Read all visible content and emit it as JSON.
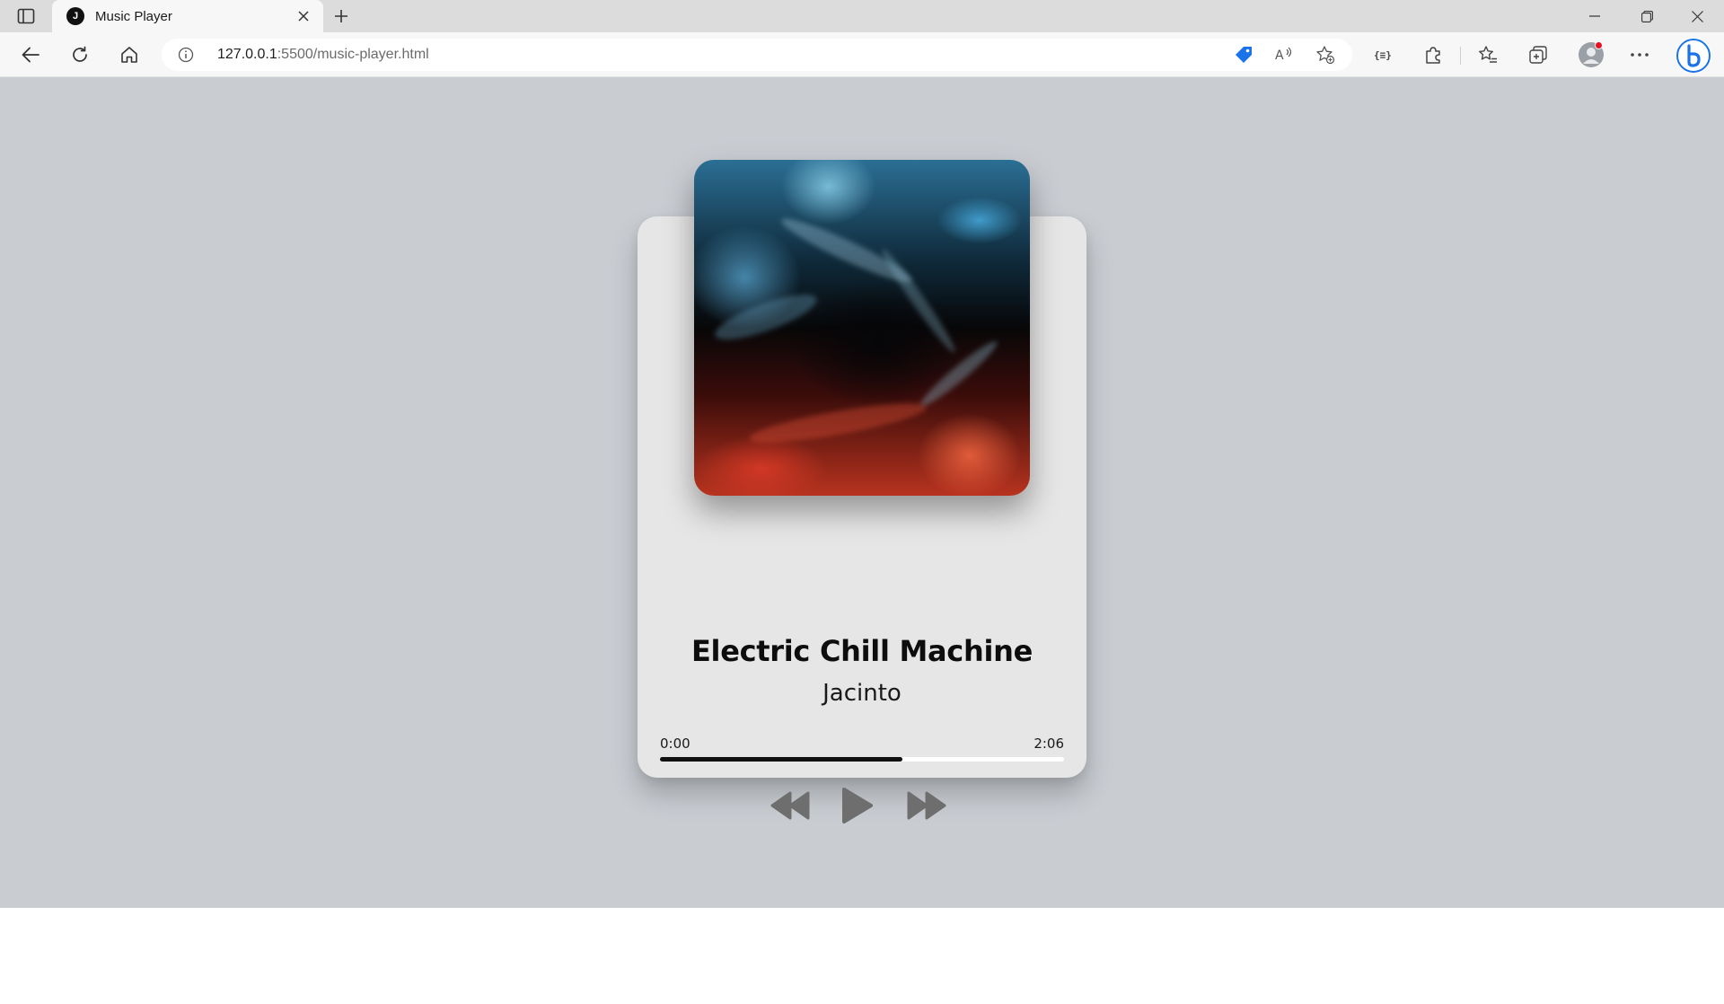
{
  "browser": {
    "tab": {
      "title": "Music Player",
      "favicon_letter": "J"
    },
    "address": {
      "host": "127.0.0.1",
      "rest": ":5500/music-player.html"
    }
  },
  "player": {
    "song_title": "Electric Chill Machine",
    "artist": "Jacinto",
    "current_time": "0:00",
    "duration": "2:06",
    "progress_fraction": 0.6,
    "controls": [
      "rewind-icon",
      "play-icon",
      "fast-forward-icon"
    ]
  },
  "colors": {
    "page_background": "#c9cdd2",
    "card_background": "#e6e6e6",
    "progress_fill": "#111111",
    "progress_track": "#ffffff",
    "control_icon": "#6e6e6e"
  }
}
